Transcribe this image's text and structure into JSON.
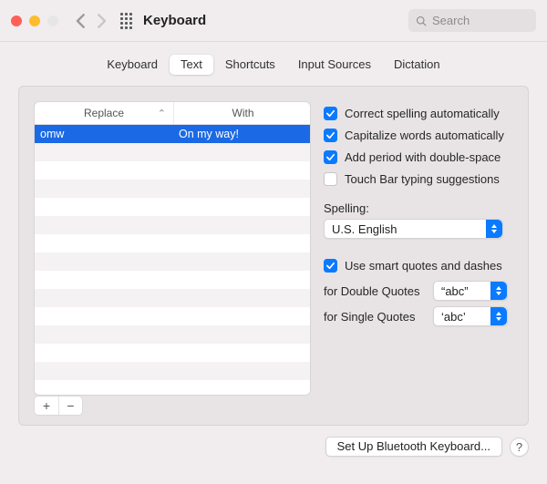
{
  "header": {
    "title": "Keyboard",
    "search_placeholder": "Search"
  },
  "tabs": {
    "items": [
      "Keyboard",
      "Text",
      "Shortcuts",
      "Input Sources",
      "Dictation"
    ],
    "active_index": 1
  },
  "replacements": {
    "columns": {
      "replace": "Replace",
      "with": "With"
    },
    "rows": [
      {
        "replace": "omw",
        "with": "On my way!",
        "selected": true
      }
    ]
  },
  "options": {
    "correct_spelling": {
      "label": "Correct spelling automatically",
      "checked": true
    },
    "capitalize_words": {
      "label": "Capitalize words automatically",
      "checked": true
    },
    "add_period": {
      "label": "Add period with double-space",
      "checked": true
    },
    "touch_bar": {
      "label": "Touch Bar typing suggestions",
      "checked": false
    }
  },
  "spelling": {
    "label": "Spelling:",
    "value": "U.S. English"
  },
  "smart_quotes": {
    "use": {
      "label": "Use smart quotes and dashes",
      "checked": true
    },
    "double": {
      "label": "for Double Quotes",
      "value": "“abc”"
    },
    "single": {
      "label": "for Single Quotes",
      "value": "‘abc’"
    }
  },
  "buttons": {
    "bluetooth": "Set Up Bluetooth Keyboard...",
    "add": "+",
    "remove": "−",
    "help": "?"
  }
}
